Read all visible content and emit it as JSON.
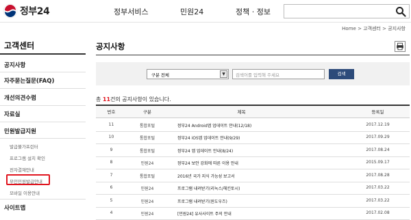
{
  "header": {
    "logo_text": "정부24",
    "nav": [
      "정부서비스",
      "민원24",
      "정책 · 정보"
    ],
    "search_icon": "search-icon"
  },
  "breadcrumb": "Home > 고객센터 > 공지사항",
  "sidebar": {
    "title": "고객센터",
    "items": [
      "공지사항",
      "자주묻는질문(FAQ)",
      "개선의견수렴",
      "자료실",
      "민원발급지원"
    ],
    "sub_items": [
      "발급불가프린터",
      "프로그램 설치 확인",
      "전자결재안내",
      "무인민원발급안내",
      "모바일 이용안내"
    ],
    "last_item": "사이트맵",
    "highlight_color": "#e0141e"
  },
  "main": {
    "title": "공지사항",
    "print_icon": "print-icon",
    "filter": {
      "select_value": "구분 전체",
      "input_placeholder": "검색어를 입력해 주세요",
      "search_label": "검색"
    },
    "count_prefix": "총 ",
    "count_value": "11",
    "count_suffix": "건의 공지사항이 있습니다.",
    "table": {
      "headers": [
        "번호",
        "구분",
        "제목",
        "등록일"
      ],
      "rows": [
        {
          "no": "11",
          "cat": "통합포털",
          "title": "정부24 Android앱 업데이트 안내(12/18)",
          "date": "2017.12.19"
        },
        {
          "no": "10",
          "cat": "통합포털",
          "title": "정부24 iOS앱 업데이트 안내(9/29)",
          "date": "2017.09.29"
        },
        {
          "no": "9",
          "cat": "통합포털",
          "title": "정부24 앱 업데이트 안내(8/24)",
          "date": "2017.08.24"
        },
        {
          "no": "8",
          "cat": "민원24",
          "title": "정부24 보안 강화에 따른 이용 안내",
          "date": "2015.09.17"
        },
        {
          "no": "7",
          "cat": "통합포털",
          "title": "2016년 국가 지식 가능성 보고서",
          "date": "2017.08.28"
        },
        {
          "no": "6",
          "cat": "민원24",
          "title": "프로그램 내려받기(리눅스/헤킨토시)",
          "date": "2017.03.22"
        },
        {
          "no": "5",
          "cat": "민원24",
          "title": "프로그램 내려받기(윈도우즈)",
          "date": "2017.03.22"
        },
        {
          "no": "4",
          "cat": "민원24",
          "title": "[민원24] 유사사이트 주의 안내",
          "date": "2017.02.08"
        }
      ]
    }
  },
  "colors": {
    "accent": "#2d4b7a",
    "highlight": "#e0141e"
  }
}
